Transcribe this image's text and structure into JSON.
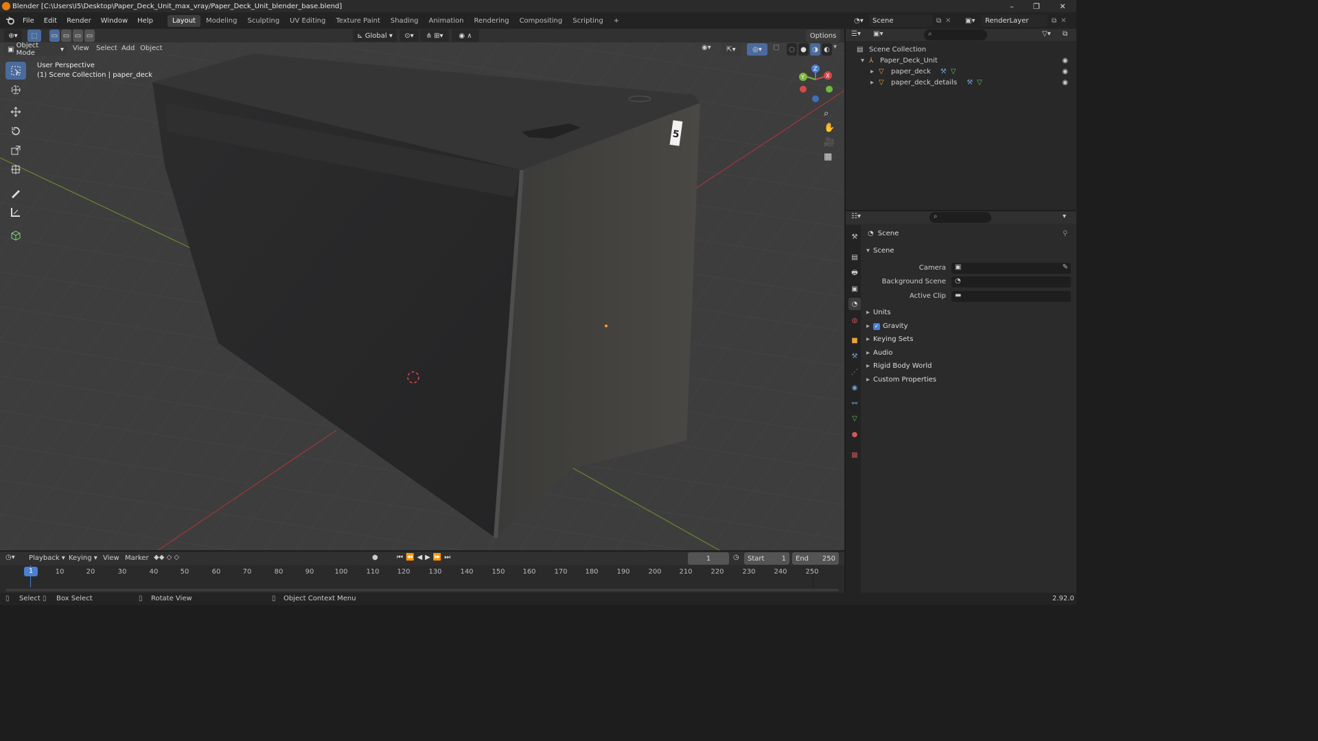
{
  "window": {
    "title": "Blender [C:\\Users\\I5\\Desktop\\Paper_Deck_Unit_max_vray/Paper_Deck_Unit_blender_base.blend]",
    "controls": [
      "–",
      "❐",
      "✕"
    ]
  },
  "menu": [
    "File",
    "Edit",
    "Render",
    "Window",
    "Help"
  ],
  "workspaces": [
    "Layout",
    "Modeling",
    "Sculpting",
    "UV Editing",
    "Texture Paint",
    "Shading",
    "Animation",
    "Rendering",
    "Compositing",
    "Scripting",
    "+"
  ],
  "active_workspace": "Layout",
  "scene_selector": "Scene",
  "view_layer_selector": "RenderLayer",
  "viewport_header": {
    "transform_orientation": "Global",
    "options": "Options",
    "mode": "Object Mode",
    "menus": [
      "View",
      "Select",
      "Add",
      "Object"
    ]
  },
  "viewport": {
    "perspective": "User Perspective",
    "collection_info": "(1) Scene Collection | paper_deck",
    "label_on_model": "5",
    "gizmo": {
      "x": "X",
      "y": "Y",
      "z": "Z"
    }
  },
  "tools": [
    "select-box",
    "cursor",
    "move",
    "rotate",
    "scale",
    "transform",
    "annotate",
    "measure",
    "add-cube"
  ],
  "outliner": {
    "root": "Scene Collection",
    "items": [
      {
        "name": "Paper_Deck_Unit",
        "level": 1
      },
      {
        "name": "paper_deck",
        "level": 2
      },
      {
        "name": "paper_deck_details",
        "level": 2
      }
    ]
  },
  "properties": {
    "header": "Scene",
    "section": "Scene",
    "fields": [
      {
        "label": "Camera",
        "value": ""
      },
      {
        "label": "Background Scene",
        "value": ""
      },
      {
        "label": "Active Clip",
        "value": ""
      }
    ],
    "panels": [
      "Units",
      "Gravity",
      "Keying Sets",
      "Audio",
      "Rigid Body World",
      "Custom Properties"
    ],
    "gravity_checked": true
  },
  "timeline": {
    "menus": [
      "Playback",
      "Keying",
      "View",
      "Marker"
    ],
    "current_frame": "1",
    "start_label": "Start",
    "start": "1",
    "end_label": "End",
    "end": "250",
    "ticks": [
      "1",
      "10",
      "20",
      "30",
      "40",
      "50",
      "60",
      "70",
      "80",
      "90",
      "100",
      "110",
      "120",
      "130",
      "140",
      "150",
      "160",
      "170",
      "180",
      "190",
      "200",
      "210",
      "220",
      "230",
      "240",
      "250"
    ]
  },
  "statusbar": {
    "select": "Select",
    "box_select": "Box Select",
    "rotate_view": "Rotate View",
    "context_menu": "Object Context Menu",
    "version": "2.92.0"
  }
}
